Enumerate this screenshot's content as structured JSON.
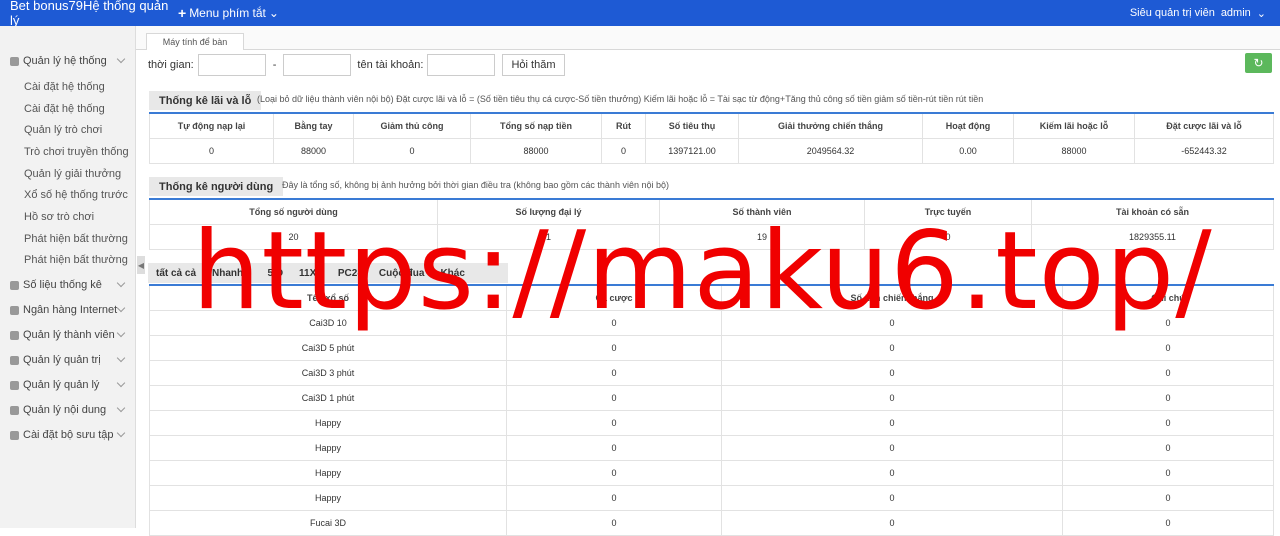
{
  "header": {
    "brand": "Bet bonus79Hệ thống quản lý",
    "shortcut_menu": "Menu phím tắt",
    "role": "Siêu quản trị viên",
    "user": "admin"
  },
  "sidebar": {
    "groups": [
      {
        "label": "Quản lý hệ thống"
      },
      {
        "label": "Số liệu thống kê"
      },
      {
        "label": "Ngân hàng Internet"
      },
      {
        "label": "Quản lý thành viên"
      },
      {
        "label": "Quản lý quản trị"
      },
      {
        "label": "Quản lý quản lý"
      },
      {
        "label": "Quản lý nội dung"
      },
      {
        "label": "Cài đặt bộ sưu tập"
      }
    ],
    "sub_items": [
      "Cài đặt hệ thống",
      "Cài đặt hệ thống",
      "Quản lý trò chơi",
      "Trò chơi truyền thống",
      "Quản lý giải thưởng",
      "Xổ số hệ thống trước",
      "Hồ sơ trò chơi",
      "Phát hiện bất thường",
      "Phát hiện bất thường"
    ]
  },
  "tab": {
    "label": "Máy tính để bàn"
  },
  "filter": {
    "time_label": "thời gian:",
    "dash": "-",
    "account_label": "tên tài khoản:",
    "query_button": "Hỏi thăm"
  },
  "profit": {
    "title": "Thống kê lãi và lỗ",
    "note": "(Loại bỏ dữ liệu thành viên nội bộ)  Đặt cược lãi và lỗ = (Số tiền tiêu thụ cá cược-Số tiền thưởng)    Kiếm lãi hoặc lỗ = Tài sạc từ động+Tăng thủ công số tiền giảm số tiền-rút tiền rút tiền",
    "headers": [
      "Tự động nạp lại",
      "Bằng tay",
      "Giảm thủ công",
      "Tổng số nạp tiền",
      "Rút",
      "Số tiêu thụ",
      "Giải thưởng chiến thắng",
      "Hoạt động",
      "Kiếm lãi hoặc lỗ",
      "Đặt cược lãi và lỗ"
    ],
    "values": [
      "0",
      "88000",
      "0",
      "88000",
      "0",
      "1397121.00",
      "2049564.32",
      "0.00",
      "88000",
      "-652443.32"
    ]
  },
  "users": {
    "title": "Thống kê người dùng",
    "note": "Đây là tổng số, không bị ảnh hưởng bởi thời gian điều tra (không bao gồm các thành viên nội bộ)",
    "headers": [
      "Tổng số người dùng",
      "Số lượng đại lý",
      "Số thành viên",
      "Trực tuyến",
      "Tài khoản có sẵn"
    ],
    "values": [
      "20",
      "1",
      "19",
      "0",
      "1829355.11"
    ]
  },
  "categories": [
    "tất cả cả",
    "Nhanh 3",
    "5 D",
    "11X5",
    "PC28",
    "Cuộc đua",
    "Khác"
  ],
  "lottery": {
    "headers": [
      "Tên xổ số",
      "Cá cược",
      "Số tiền chiến thắng",
      "Ghi chú"
    ],
    "rows": [
      [
        "Cai3D 10",
        "0",
        "0",
        "0"
      ],
      [
        "Cai3D 5 phút",
        "0",
        "0",
        "0"
      ],
      [
        "Cai3D 3 phút",
        "0",
        "0",
        "0"
      ],
      [
        "Cai3D 1 phút",
        "0",
        "0",
        "0"
      ],
      [
        "Happy",
        "0",
        "0",
        "0"
      ],
      [
        "Happy",
        "0",
        "0",
        "0"
      ],
      [
        "Happy",
        "0",
        "0",
        "0"
      ],
      [
        "Happy",
        "0",
        "0",
        "0"
      ],
      [
        "Fucai 3D",
        "0",
        "0",
        "0"
      ]
    ]
  },
  "watermark": "https://maku6.top/",
  "colors": {
    "topbar": "#1e5ad4",
    "accent": "#3a7bd5",
    "refresh": "#5cb85c",
    "watermark": "#f00000"
  }
}
